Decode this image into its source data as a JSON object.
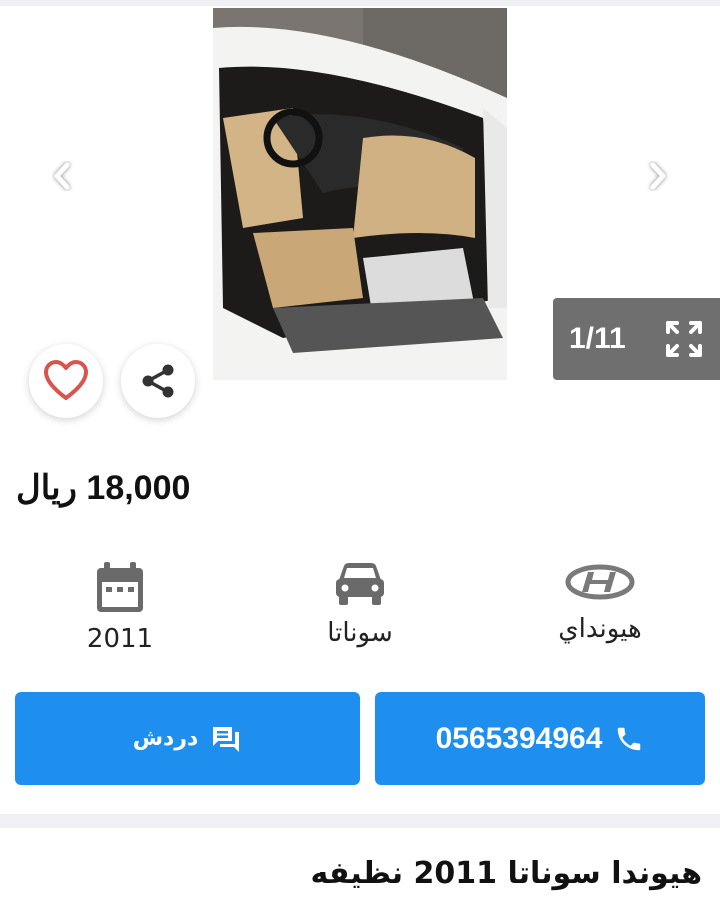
{
  "gallery": {
    "counter": "1/11",
    "image_alt": "car interior photo"
  },
  "listing": {
    "price_value": "18,000",
    "price_currency": "ريال",
    "title": "هيوندا سوناتا 2011 نظيفه"
  },
  "specs": {
    "brand": "هيونداي",
    "model": "سوناتا",
    "year": "2011"
  },
  "actions": {
    "phone": "0565394964",
    "chat_label": "دردش"
  },
  "colors": {
    "primary": "#1e8fee",
    "favorite": "#d9534f",
    "counter_bg": "#6f6f6f"
  }
}
